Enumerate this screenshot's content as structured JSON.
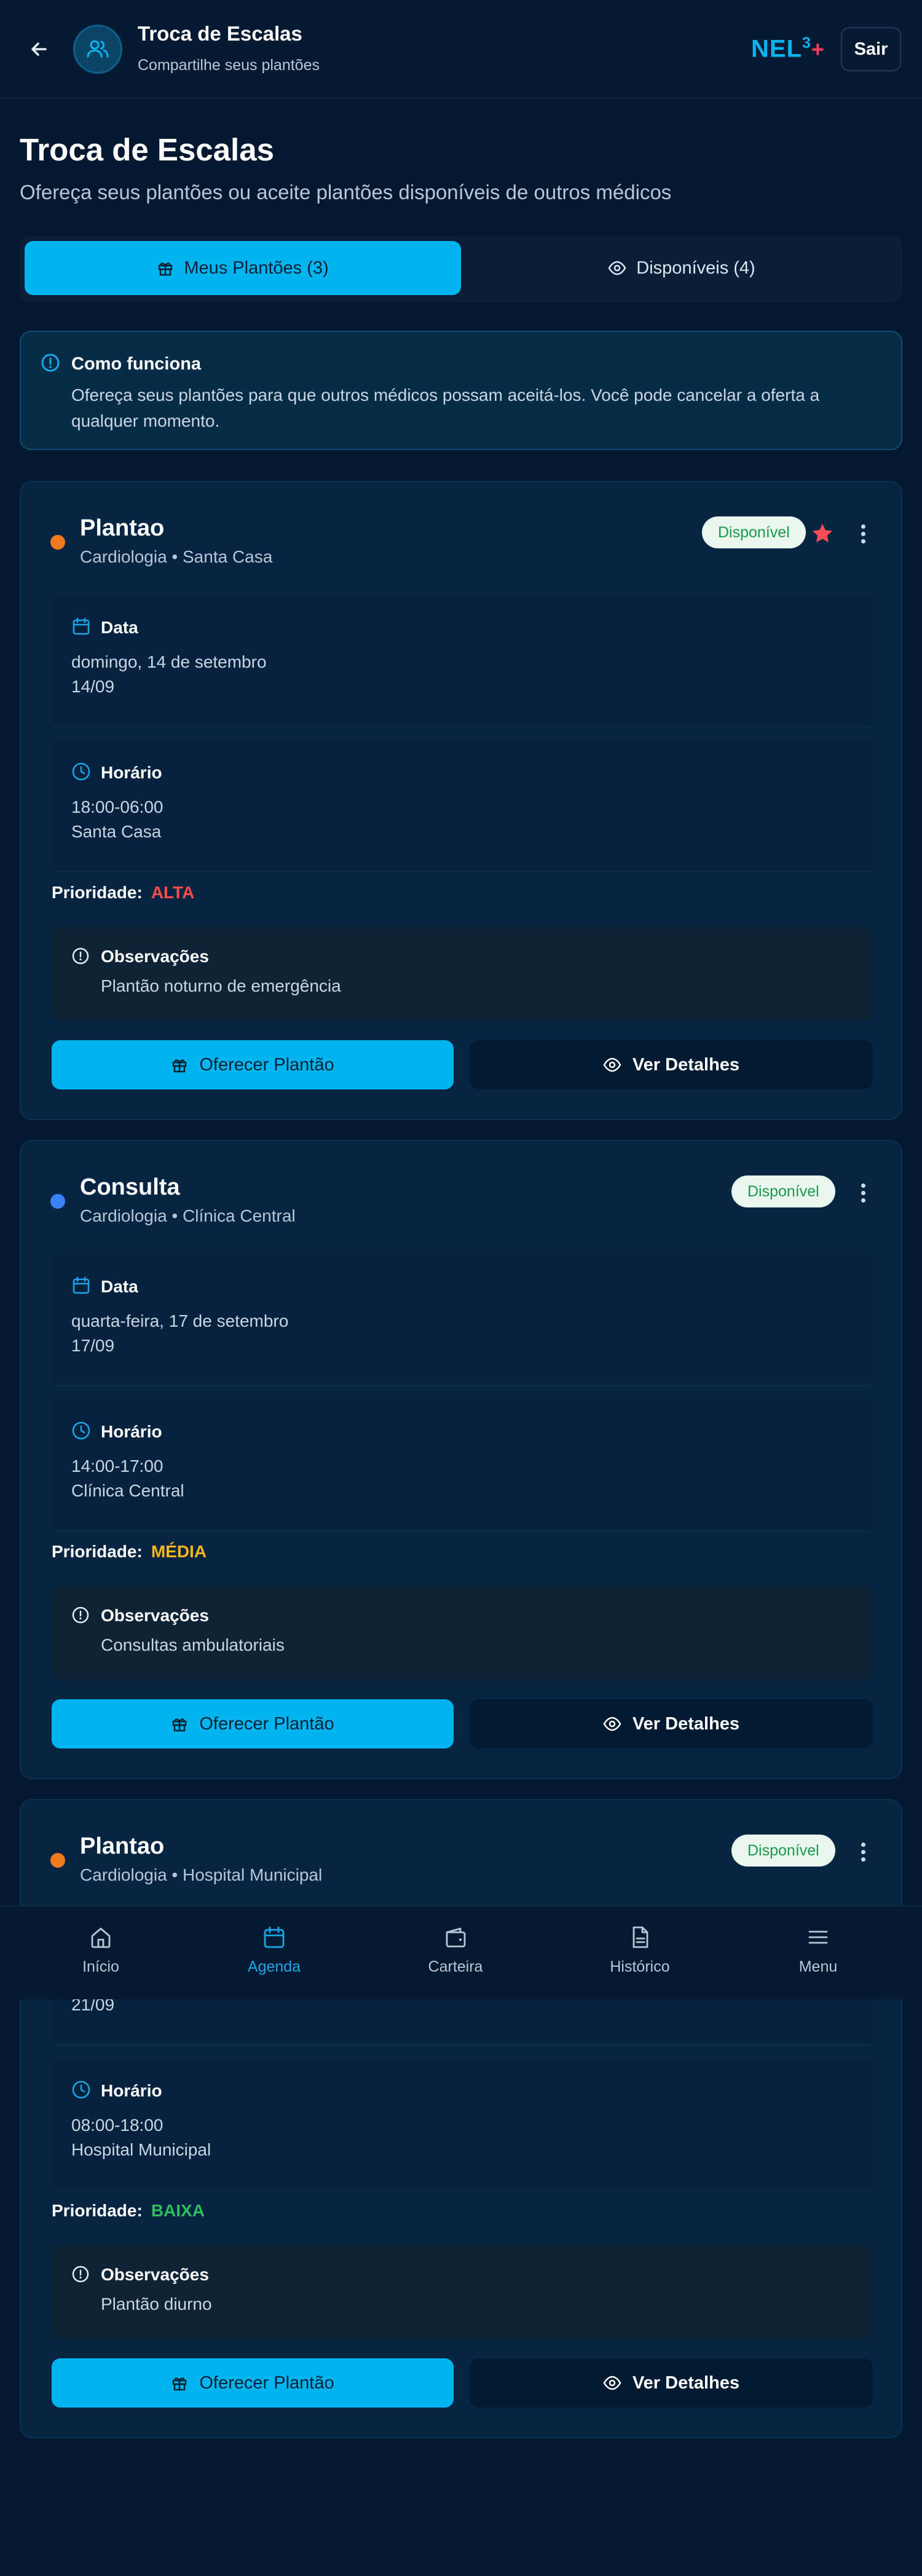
{
  "header": {
    "title": "Troca de Escalas",
    "subtitle": "Compartilhe seus plantões",
    "brand": "NEL",
    "brand_sup": "3",
    "brand_plus": "+",
    "logout_label": "Sair"
  },
  "page": {
    "title": "Troca de Escalas",
    "subtitle": "Ofereça seus plantões ou aceite plantões disponíveis de outros médicos"
  },
  "tabs": [
    {
      "label": "Meus Plantões (3)",
      "icon": "gift-icon",
      "active": true
    },
    {
      "label": "Disponíveis (4)",
      "icon": "eye-icon",
      "active": false
    }
  ],
  "info": {
    "title": "Como funciona",
    "text": "Ofereça seus plantões para que outros médicos possam aceitá-los. Você pode cancelar a oferta a qualquer momento."
  },
  "labels": {
    "date": "Data",
    "time": "Horário",
    "priority": "Prioridade:",
    "notes": "Observações",
    "offer_button": "Oferecer Plantão",
    "details_button": "Ver Detalhes"
  },
  "shifts": [
    {
      "title": "Plantao",
      "subtitle": "Cardiologia • Santa Casa",
      "dot_color": "#f07a1e",
      "badge": "Disponível",
      "starred": true,
      "date_long": "domingo, 14 de setembro",
      "date_short": "14/09",
      "time": "18:00-06:00",
      "location": "Santa Casa",
      "priority": "ALTA",
      "priority_color": "#ff4d4d",
      "notes": "Plantão noturno de emergência"
    },
    {
      "title": "Consulta",
      "subtitle": "Cardiologia • Clínica Central",
      "dot_color": "#3b82f6",
      "badge": "Disponível",
      "starred": false,
      "date_long": "quarta-feira, 17 de setembro",
      "date_short": "17/09",
      "time": "14:00-17:00",
      "location": "Clínica Central",
      "priority": "MÉDIA",
      "priority_color": "#f5b619",
      "notes": "Consultas ambulatoriais"
    },
    {
      "title": "Plantao",
      "subtitle": "Cardiologia • Hospital Municipal",
      "dot_color": "#f07a1e",
      "badge": "Disponível",
      "starred": false,
      "date_short": "21/09",
      "time": "08:00-18:00",
      "location": "Hospital Municipal",
      "priority": "BAIXA",
      "priority_color": "#2fbf5a",
      "notes": "Plantão diurno"
    }
  ],
  "bottom_nav": [
    {
      "label": "Início",
      "icon": "home-icon",
      "active": false
    },
    {
      "label": "Agenda",
      "icon": "calendar-icon",
      "active": true
    },
    {
      "label": "Carteira",
      "icon": "wallet-icon",
      "active": false
    },
    {
      "label": "Histórico",
      "icon": "document-icon",
      "active": false
    },
    {
      "label": "Menu",
      "icon": "menu-icon",
      "active": false
    }
  ],
  "colors": {
    "background": "#041830",
    "accent": "#00b4f0",
    "badge_bg": "#e9f7ee",
    "badge_text": "#1a9a4c",
    "star": "#ff4d5a"
  }
}
